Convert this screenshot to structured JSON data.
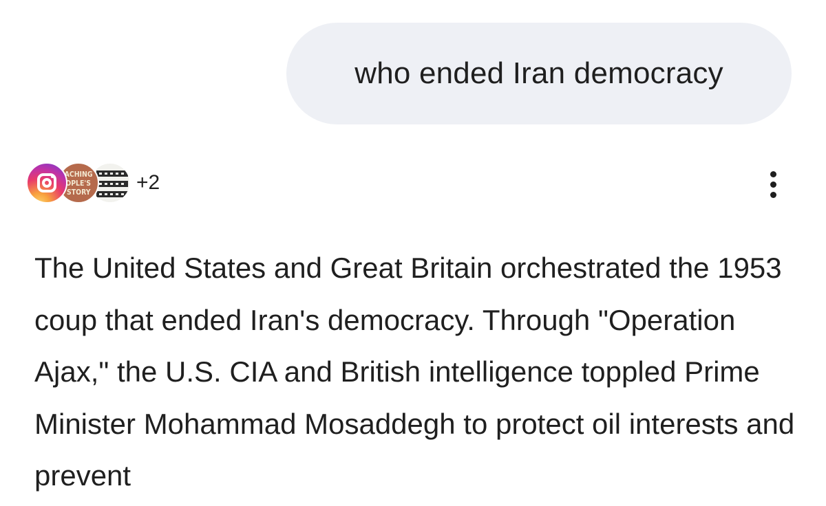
{
  "user_prompt": {
    "text": "who ended Iran democracy"
  },
  "sources": {
    "icons": [
      {
        "name": "instagram-icon"
      },
      {
        "name": "story-channel-icon",
        "text_lines": [
          "ACHING",
          "OPLE'S",
          "STORY"
        ]
      },
      {
        "name": "film-strip-icon"
      }
    ],
    "more_count": "+2"
  },
  "response": {
    "menu_icon": "more-vert-icon",
    "text": "The United States and Great Britain orchestrated the 1953 coup that ended Iran's democracy. Through \"Operation Ajax,\" the U.S. CIA and British intelligence toppled Prime Minister Mohammad Mosaddegh to protect oil interests and prevent"
  },
  "colors": {
    "bubble_bg": "#eef0f5",
    "text": "#1f1f1f",
    "background": "#ffffff"
  }
}
